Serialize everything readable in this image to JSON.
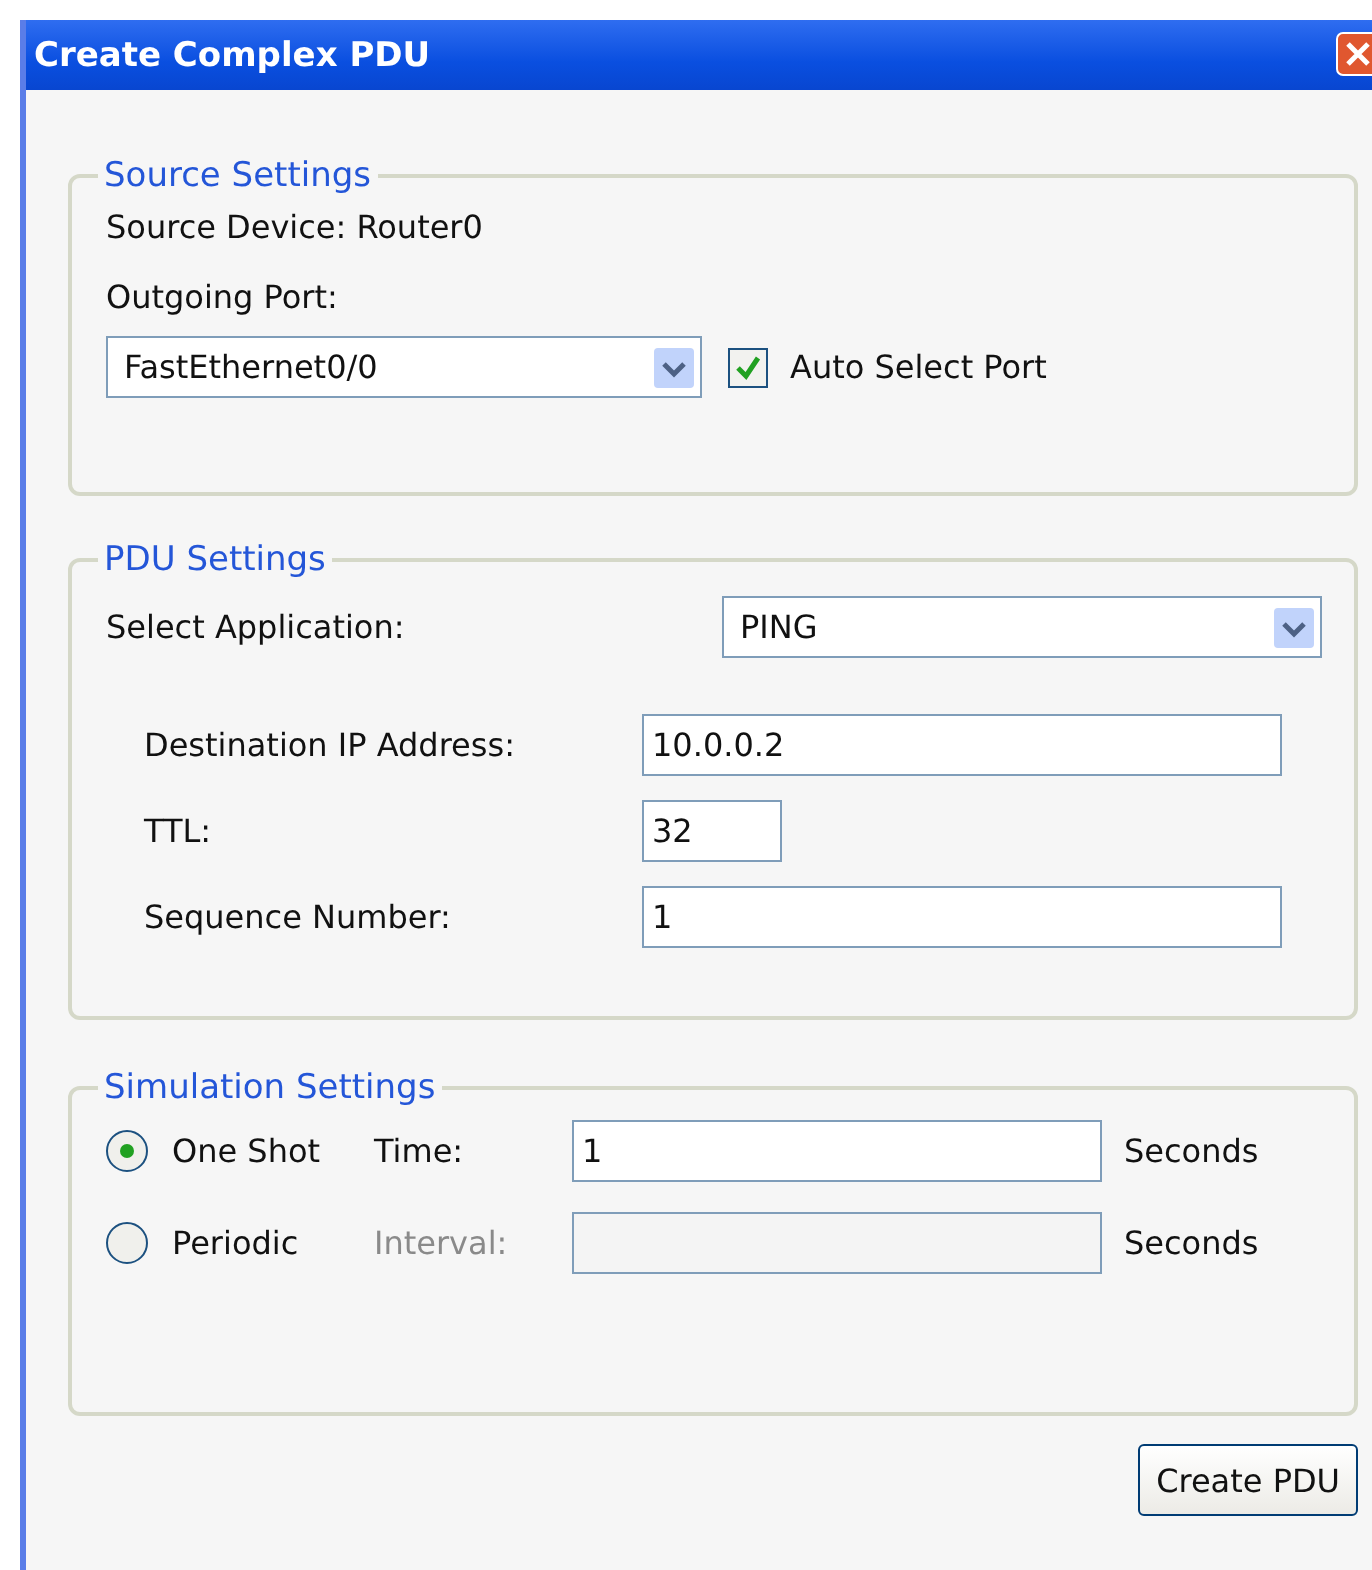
{
  "window": {
    "title": "Create Complex PDU"
  },
  "source_settings": {
    "title": "Source Settings",
    "source_device": "Source Device: Router0",
    "outgoing_port_label": "Outgoing Port:",
    "port": "FastEthernet0/0",
    "auto_select": {
      "label": "Auto Select Port",
      "checked": true
    }
  },
  "pdu_settings": {
    "title": "PDU Settings",
    "application_label": "Select Application:",
    "application": "PING",
    "fields": [
      {
        "label": "Destination IP Address:",
        "value": "10.0.0.2",
        "kind": "wide"
      },
      {
        "label": "TTL:",
        "value": "32",
        "kind": "short"
      },
      {
        "label": "Sequence Number:",
        "value": "1",
        "kind": "wide"
      }
    ]
  },
  "simulation_settings": {
    "title": "Simulation Settings",
    "modes": [
      {
        "label": "One Shot",
        "selected": true,
        "field_label": "Time:",
        "value": "1",
        "disabled": false,
        "unit": "Seconds"
      },
      {
        "label": "Periodic",
        "selected": false,
        "field_label": "Interval:",
        "disabled": true,
        "unit": "Seconds"
      }
    ]
  },
  "buttons": [
    "Create PDU"
  ]
}
